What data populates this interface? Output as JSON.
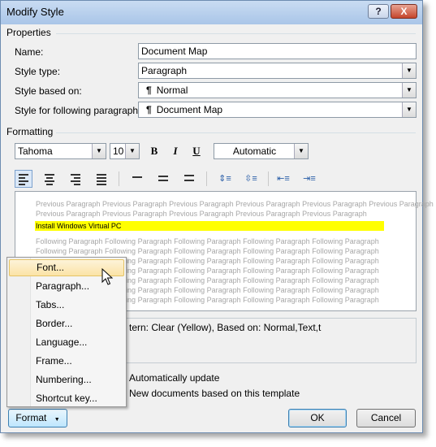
{
  "window": {
    "title": "Modify Style",
    "help_label": "?",
    "close_label": "X"
  },
  "properties": {
    "section_label": "Properties",
    "name_label": "Name:",
    "name_value": "Document Map",
    "style_type_label": "Style type:",
    "style_type_value": "Paragraph",
    "based_on_label": "Style based on:",
    "based_on_value": "Normal",
    "following_label": "Style for following paragraph:",
    "following_value": "Document Map",
    "pilcrow": "¶"
  },
  "formatting": {
    "section_label": "Formatting",
    "font": "Tahoma",
    "size": "10",
    "bold": "B",
    "italic": "I",
    "underline": "U",
    "color": "Automatic"
  },
  "preview": {
    "prev_1": "Previous Paragraph Previous Paragraph Previous Paragraph Previous Paragraph Previous Paragraph Previous Paragraph",
    "prev_2": "Previous Paragraph Previous Paragraph Previous Paragraph Previous Paragraph Previous Paragraph",
    "sample": "Install Windows Virtual PC",
    "follow": [
      "Following Paragraph Following Paragraph Following Paragraph Following Paragraph Following Paragraph",
      "Following Paragraph Following Paragraph Following Paragraph Following Paragraph Following Paragraph",
      "Following Paragraph Following Paragraph Following Paragraph Following Paragraph Following Paragraph",
      "Following Paragraph Following Paragraph Following Paragraph Following Paragraph Following Paragraph",
      "Following Paragraph Following Paragraph Following Paragraph Following Paragraph Following Paragraph",
      "Following Paragraph Following Paragraph Following Paragraph Following Paragraph Following Paragraph",
      "Following Paragraph Following Paragraph Following Paragraph Following Paragraph Following Paragraph"
    ]
  },
  "description": "tern: Clear (Yellow), Based on: Normal,Text,t",
  "options": {
    "auto_update": "Automatically update",
    "new_docs": "New documents based on this template"
  },
  "buttons": {
    "format": "Format",
    "format_arrow": "▼",
    "ok": "OK",
    "cancel": "Cancel"
  },
  "format_menu": {
    "items": [
      "Font...",
      "Paragraph...",
      "Tabs...",
      "Border...",
      "Language...",
      "Frame...",
      "Numbering...",
      "Shortcut key..."
    ],
    "hovered": "Font..."
  }
}
